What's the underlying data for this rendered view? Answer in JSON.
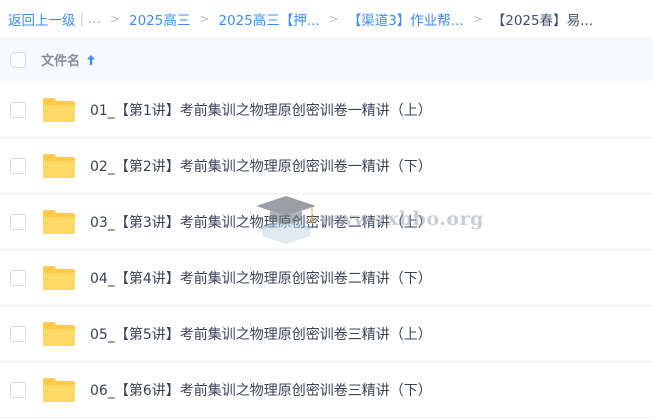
{
  "breadcrumb": {
    "back": "返回上一级",
    "ellipsis": "...",
    "items": [
      "2025高三",
      "2025高三【押...",
      "【渠道3】作业帮...",
      "【2025春】易..."
    ]
  },
  "list_header": {
    "column_name": "文件名"
  },
  "files": [
    {
      "name": "01_【第1讲】考前集训之物理原创密训卷一精讲（上）"
    },
    {
      "name": "02_【第2讲】考前集训之物理原创密训卷一精讲（下）"
    },
    {
      "name": "03_【第3讲】考前集训之物理原创密训卷二精讲（上）"
    },
    {
      "name": "04_【第4讲】考前集训之物理原创密训卷二精讲（下）"
    },
    {
      "name": "05_【第5讲】考前集训之物理原创密训卷三精讲（上）"
    },
    {
      "name": "06_【第6讲】考前集训之物理原创密训卷三精讲（下）"
    }
  ],
  "watermark": {
    "text": "www.zxbbo.org"
  },
  "colors": {
    "link": "#3b8cff",
    "folder": "#ffd15c",
    "header_bg": "#f6f9fd"
  }
}
